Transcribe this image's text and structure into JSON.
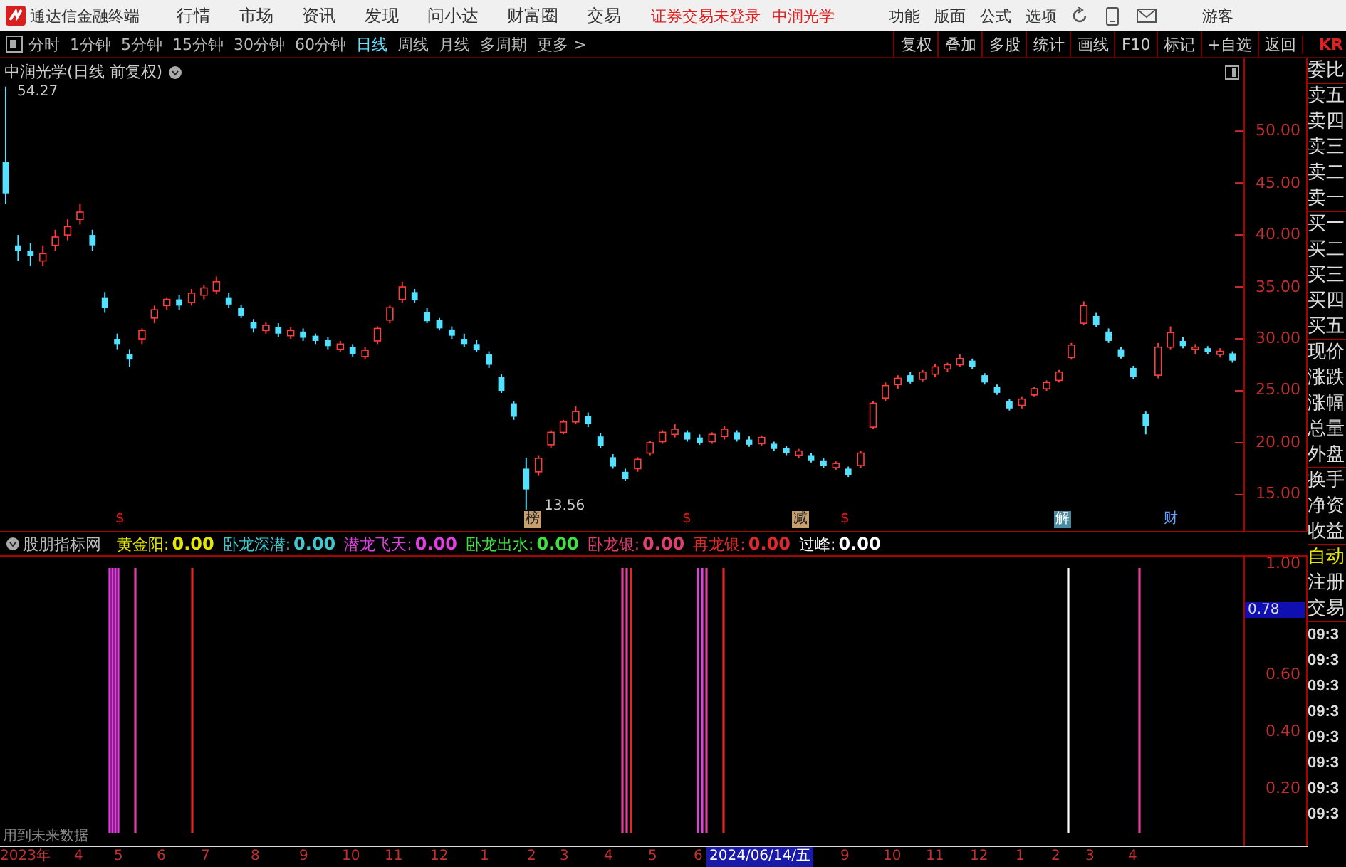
{
  "top_menu": {
    "app_title": "通达信金融终端",
    "menus": [
      "行情",
      "市场",
      "资讯",
      "发现",
      "问小达",
      "财富圈",
      "交易"
    ],
    "status": [
      "证券交易未登录",
      "中润光学"
    ],
    "actions": [
      "功能",
      "版面",
      "公式",
      "选项"
    ],
    "user": "游客"
  },
  "toolbar": {
    "periods": [
      {
        "label": "分时",
        "selected": false
      },
      {
        "label": "1分钟",
        "selected": false
      },
      {
        "label": "5分钟",
        "selected": false
      },
      {
        "label": "15分钟",
        "selected": false
      },
      {
        "label": "30分钟",
        "selected": false
      },
      {
        "label": "60分钟",
        "selected": false
      },
      {
        "label": "日线",
        "selected": true
      },
      {
        "label": "周线",
        "selected": false
      },
      {
        "label": "月线",
        "selected": false
      },
      {
        "label": "多周期",
        "selected": false
      },
      {
        "label": "更多 >",
        "selected": false
      }
    ],
    "buttons": [
      "复权",
      "叠加",
      "多股",
      "统计",
      "画线",
      "F10",
      "标记",
      "+自选",
      "返回"
    ],
    "corner": "KR"
  },
  "price_chart": {
    "title": "中润光学(日线 前复权)",
    "high_label": "54.27",
    "low_label": "13.56",
    "chart_data": {
      "type": "candlestick",
      "ylim": [
        11.5,
        57
      ],
      "yticks": [
        {
          "value": 50,
          "label": "50.00"
        },
        {
          "value": 45,
          "label": "45.00"
        },
        {
          "value": 40,
          "label": "40.00"
        },
        {
          "value": 35,
          "label": "35.00"
        },
        {
          "value": 30,
          "label": "30.00"
        },
        {
          "value": 25,
          "label": "25.00"
        },
        {
          "value": 20,
          "label": "20.00"
        },
        {
          "value": 15,
          "label": "15.00"
        }
      ],
      "ohlc": [
        [
          47,
          54.27,
          43,
          44
        ],
        [
          39,
          40,
          37.5,
          38.5
        ],
        [
          38.5,
          39.2,
          37,
          38
        ],
        [
          37.5,
          39,
          37,
          38.2
        ],
        [
          39,
          40.5,
          38.5,
          39.8
        ],
        [
          40,
          41.5,
          39.5,
          40.8
        ],
        [
          41.5,
          43,
          41,
          42.2
        ],
        [
          40,
          40.5,
          38.5,
          39
        ],
        [
          34,
          34.5,
          32.5,
          33
        ],
        [
          30,
          30.5,
          29,
          29.5
        ],
        [
          28.5,
          29,
          27.3,
          28
        ],
        [
          30,
          31,
          29.5,
          30.8
        ],
        [
          32,
          33.2,
          31.5,
          32.8
        ],
        [
          33.2,
          34,
          32.8,
          33.8
        ],
        [
          33.8,
          34.2,
          32.8,
          33.2
        ],
        [
          33.5,
          34.8,
          33.2,
          34.4
        ],
        [
          34.2,
          35.2,
          33.8,
          34.9
        ],
        [
          34.6,
          36,
          34.3,
          35.5
        ],
        [
          34,
          34.4,
          33,
          33.3
        ],
        [
          33,
          33.3,
          32,
          32.2
        ],
        [
          31.6,
          31.9,
          30.6,
          31
        ],
        [
          30.8,
          31.6,
          30.5,
          31.3
        ],
        [
          31.1,
          31.5,
          30.2,
          30.5
        ],
        [
          30.3,
          31.1,
          30,
          30.8
        ],
        [
          30.7,
          31,
          29.8,
          30.1
        ],
        [
          30.3,
          30.5,
          29.5,
          29.8
        ],
        [
          29.9,
          30.2,
          29,
          29.3
        ],
        [
          29,
          29.8,
          28.7,
          29.5
        ],
        [
          29.2,
          29.5,
          28.3,
          28.5
        ],
        [
          28.3,
          29.2,
          28,
          28.9
        ],
        [
          29.8,
          31.2,
          29.5,
          31
        ],
        [
          31.8,
          33.2,
          31.5,
          33
        ],
        [
          33.8,
          35.5,
          33.5,
          35
        ],
        [
          34.5,
          34.8,
          33.5,
          33.7
        ],
        [
          32.6,
          33,
          31.5,
          31.7
        ],
        [
          31.8,
          32,
          30.8,
          31
        ],
        [
          30.9,
          31.2,
          30,
          30.3
        ],
        [
          30,
          30.5,
          29.2,
          29.5
        ],
        [
          29.5,
          29.9,
          28.7,
          28.9
        ],
        [
          28.5,
          28.8,
          27.2,
          27.5
        ],
        [
          26.3,
          26.6,
          24.8,
          25
        ],
        [
          23.8,
          24,
          22.2,
          22.5
        ],
        [
          17.5,
          18.5,
          13.56,
          15.5
        ],
        [
          17.2,
          18.8,
          16.8,
          18.5
        ],
        [
          19.8,
          21.2,
          19.5,
          21
        ],
        [
          21,
          22.2,
          20.8,
          22
        ],
        [
          22,
          23.5,
          21.8,
          23
        ],
        [
          22.6,
          22.9,
          21.5,
          21.8
        ],
        [
          20.6,
          20.9,
          19.5,
          19.7
        ],
        [
          18.6,
          18.9,
          17.5,
          17.7
        ],
        [
          17.2,
          17.5,
          16.3,
          16.5
        ],
        [
          17.5,
          18.6,
          17.2,
          18.4
        ],
        [
          19,
          20.2,
          18.8,
          20
        ],
        [
          20.1,
          21.2,
          19.9,
          21
        ],
        [
          20.8,
          21.8,
          20.5,
          21.3
        ],
        [
          21,
          21.2,
          20.1,
          20.3
        ],
        [
          20.5,
          20.8,
          19.8,
          20
        ],
        [
          20.1,
          21,
          19.9,
          20.8
        ],
        [
          20.6,
          21.6,
          20.3,
          21.3
        ],
        [
          21,
          21.2,
          20.1,
          20.3
        ],
        [
          20.3,
          20.6,
          19.6,
          19.8
        ],
        [
          19.9,
          20.7,
          19.7,
          20.5
        ],
        [
          19.9,
          20.1,
          19.2,
          19.4
        ],
        [
          19.5,
          19.7,
          18.8,
          19
        ],
        [
          18.8,
          19.4,
          18.5,
          19.2
        ],
        [
          18.8,
          19,
          18.1,
          18.3
        ],
        [
          18.3,
          18.5,
          17.6,
          17.8
        ],
        [
          17.6,
          18.2,
          17.4,
          18
        ],
        [
          17.5,
          17.7,
          16.7,
          16.9
        ],
        [
          17.8,
          19.2,
          17.6,
          19
        ],
        [
          21.5,
          24,
          21.3,
          23.8
        ],
        [
          24.3,
          25.8,
          24,
          25.5
        ],
        [
          25.6,
          26.5,
          25.2,
          26.2
        ],
        [
          26.5,
          26.8,
          25.7,
          25.9
        ],
        [
          26.1,
          27,
          25.9,
          26.8
        ],
        [
          26.6,
          27.6,
          26.3,
          27.3
        ],
        [
          27.1,
          27.7,
          26.8,
          27.5
        ],
        [
          27.5,
          28.5,
          27.3,
          28.1
        ],
        [
          27.9,
          28.1,
          27.1,
          27.3
        ],
        [
          26.5,
          26.7,
          25.6,
          25.8
        ],
        [
          25.4,
          25.6,
          24.6,
          24.8
        ],
        [
          24,
          24.2,
          23.1,
          23.3
        ],
        [
          23.6,
          24.4,
          23.3,
          24.2
        ],
        [
          24.6,
          25.4,
          24.4,
          25.2
        ],
        [
          25.2,
          26,
          25,
          25.8
        ],
        [
          26,
          27,
          25.8,
          26.8
        ],
        [
          28.2,
          29.6,
          28,
          29.4
        ],
        [
          31.5,
          33.6,
          31.3,
          33.2
        ],
        [
          32.2,
          32.5,
          31.1,
          31.3
        ],
        [
          30.7,
          31,
          29.6,
          29.8
        ],
        [
          29,
          29.2,
          28.1,
          28.3
        ],
        [
          27.2,
          27.4,
          26.1,
          26.3
        ],
        [
          22.8,
          23,
          20.8,
          21.6
        ],
        [
          26.5,
          29.6,
          26.2,
          29.2
        ],
        [
          29.2,
          31.2,
          29,
          30.6
        ],
        [
          29.8,
          30.2,
          29.1,
          29.3
        ],
        [
          29,
          29.5,
          28.5,
          29.2
        ],
        [
          29.1,
          29.3,
          28.5,
          28.7
        ],
        [
          28.5,
          29.1,
          28.2,
          28.8
        ],
        [
          28.6,
          28.8,
          27.7,
          27.9
        ]
      ]
    },
    "markers": [
      {
        "label": "$",
        "kind": "dollar"
      },
      {
        "label": "榜",
        "kind": "tag"
      },
      {
        "label": "$",
        "kind": "dollar"
      },
      {
        "label": "减",
        "kind": "tag"
      },
      {
        "label": "$",
        "kind": "dollar"
      },
      {
        "label": "解",
        "kind": "note"
      },
      {
        "label": "财",
        "kind": "text"
      }
    ]
  },
  "indicator": {
    "name": "股朋指标网",
    "legend": [
      {
        "label": "黄金阳:",
        "value": "0.00",
        "color": "#e6e600"
      },
      {
        "label": "卧龙深潜:",
        "value": "0.00",
        "color": "#40c8d0"
      },
      {
        "label": "潜龙飞天:",
        "value": "0.00",
        "color": "#e040e0"
      },
      {
        "label": "卧龙出水:",
        "value": "0.00",
        "color": "#40e040"
      },
      {
        "label": "卧龙银:",
        "value": "0.00",
        "color": "#e04070"
      },
      {
        "label": "再龙银:",
        "value": "0.00",
        "color": "#e02828"
      },
      {
        "label": "过峰:",
        "value": "0.00",
        "color": "#ffffff"
      }
    ],
    "y_ticks": [
      "1.00",
      "0.60",
      "0.40",
      "0.20"
    ],
    "cursor_value": "0.78",
    "note": "用到未来数据"
  },
  "date_axis": {
    "labels": [
      {
        "label": "2023年",
        "kind": "tick"
      },
      {
        "label": "4",
        "kind": "tick"
      },
      {
        "label": "5",
        "kind": "tick"
      },
      {
        "label": "6",
        "kind": "tick"
      },
      {
        "label": "7",
        "kind": "tick"
      },
      {
        "label": "8",
        "kind": "tick"
      },
      {
        "label": "9",
        "kind": "tick"
      },
      {
        "label": "10",
        "kind": "tick"
      },
      {
        "label": "11",
        "kind": "tick"
      },
      {
        "label": "12",
        "kind": "tick"
      },
      {
        "label": "1",
        "kind": "tick"
      },
      {
        "label": "2",
        "kind": "tick"
      },
      {
        "label": "3",
        "kind": "tick"
      },
      {
        "label": "4",
        "kind": "tick"
      },
      {
        "label": "5",
        "kind": "tick"
      },
      {
        "label": "6",
        "kind": "tick"
      },
      {
        "label": "2024/06/14/五",
        "kind": "cursor"
      },
      {
        "label": "9",
        "kind": "tick"
      },
      {
        "label": "10",
        "kind": "tick"
      },
      {
        "label": "11",
        "kind": "tick"
      },
      {
        "label": "12",
        "kind": "tick"
      },
      {
        "label": "1",
        "kind": "tick"
      },
      {
        "label": "2",
        "kind": "tick"
      },
      {
        "label": "3",
        "kind": "tick"
      },
      {
        "label": "4",
        "kind": "tick"
      }
    ]
  },
  "quote_panel": {
    "rows": [
      {
        "label": "委比",
        "kind": "label",
        "divider": true
      },
      {
        "label": "卖五",
        "kind": "label",
        "divider": false
      },
      {
        "label": "卖四",
        "kind": "label",
        "divider": false
      },
      {
        "label": "卖三",
        "kind": "label",
        "divider": false
      },
      {
        "label": "卖二",
        "kind": "label",
        "divider": false
      },
      {
        "label": "卖一",
        "kind": "label",
        "divider": true
      },
      {
        "label": "买一",
        "kind": "label",
        "divider": false
      },
      {
        "label": "买二",
        "kind": "label",
        "divider": false
      },
      {
        "label": "买三",
        "kind": "label",
        "divider": false
      },
      {
        "label": "买四",
        "kind": "label",
        "divider": false
      },
      {
        "label": "买五",
        "kind": "label",
        "divider": true
      },
      {
        "label": "现价",
        "kind": "label",
        "divider": false
      },
      {
        "label": "涨跌",
        "kind": "label",
        "divider": false
      },
      {
        "label": "涨幅",
        "kind": "label",
        "divider": false
      },
      {
        "label": "总量",
        "kind": "label",
        "divider": false
      },
      {
        "label": "外盘",
        "kind": "label",
        "divider": true
      },
      {
        "label": "换手",
        "kind": "label",
        "divider": false
      },
      {
        "label": "净资",
        "kind": "label",
        "divider": false
      },
      {
        "label": "收益",
        "kind": "label",
        "divider": true
      },
      {
        "label": "自动",
        "kind": "highlight",
        "divider": false
      },
      {
        "label": "注册",
        "kind": "label",
        "divider": false
      },
      {
        "label": "交易",
        "kind": "label",
        "divider": true
      },
      {
        "label": "09:3",
        "kind": "time",
        "divider": false
      },
      {
        "label": "09:3",
        "kind": "time",
        "divider": false
      },
      {
        "label": "09:3",
        "kind": "time",
        "divider": false
      },
      {
        "label": "09:3",
        "kind": "time",
        "divider": false
      },
      {
        "label": "09:3",
        "kind": "time",
        "divider": false
      },
      {
        "label": "09:3",
        "kind": "time",
        "divider": false
      },
      {
        "label": "09:3",
        "kind": "time",
        "divider": false
      },
      {
        "label": "09:3",
        "kind": "time",
        "divider": false
      }
    ]
  }
}
